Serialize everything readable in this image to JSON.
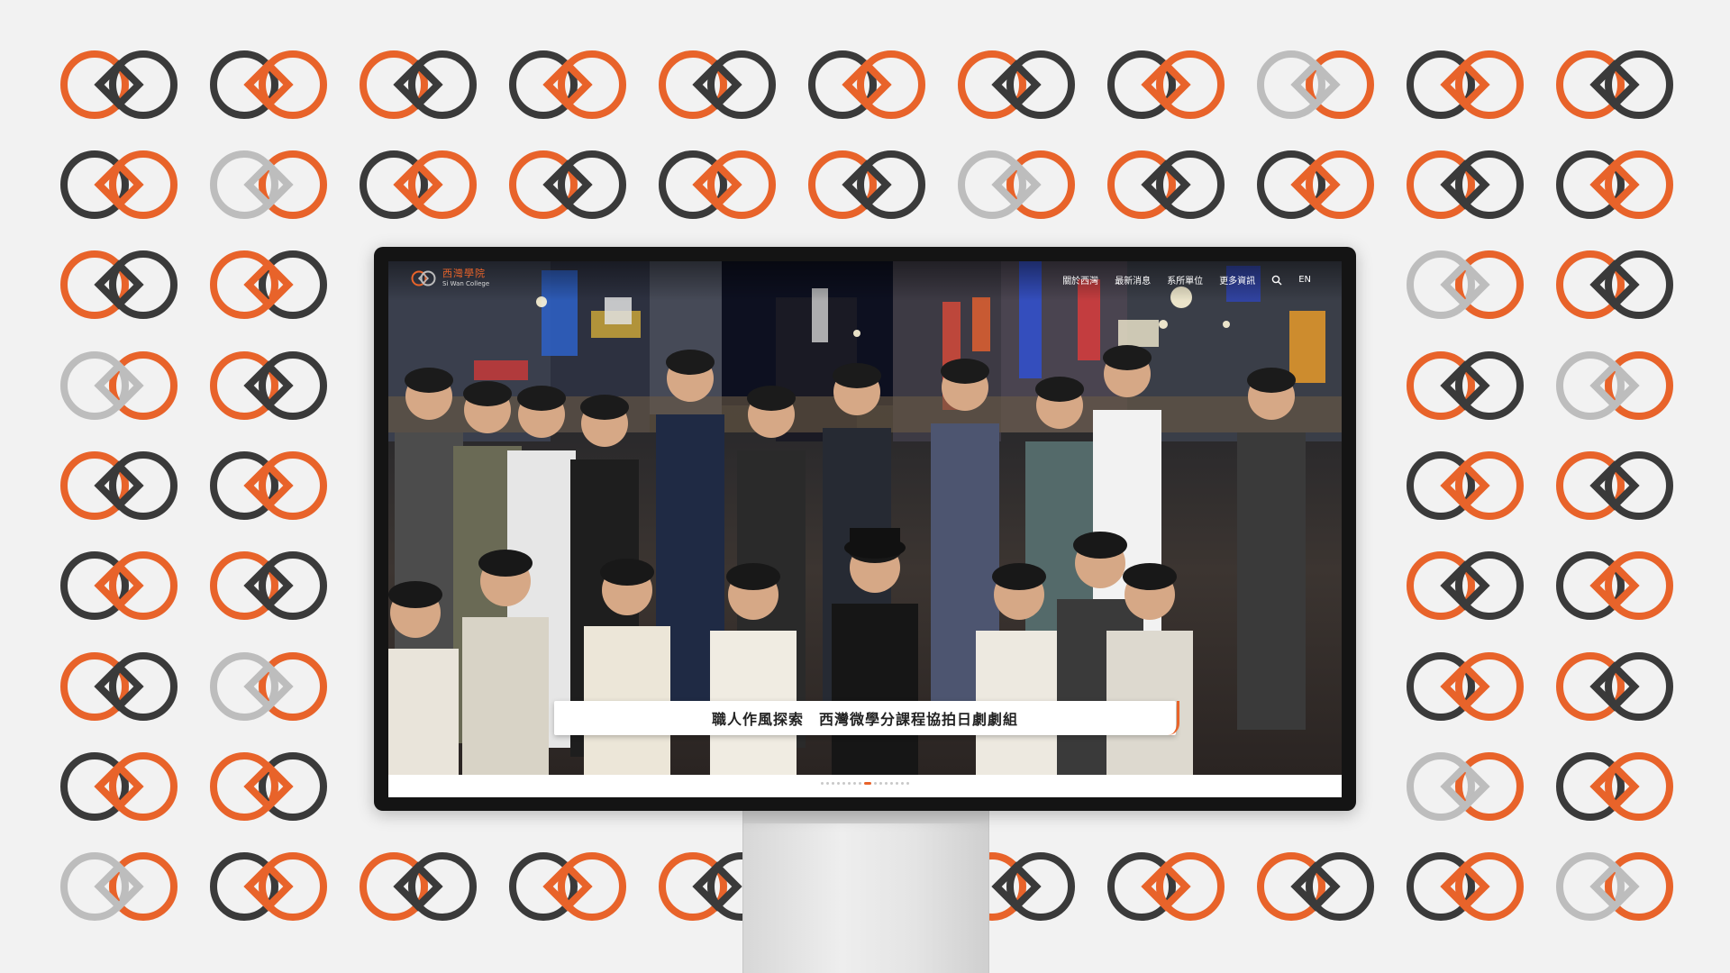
{
  "colors": {
    "accent": "#e8632a",
    "dark": "#3a3a3a",
    "light": "#bdbdbd",
    "background": "#f2f2f2"
  },
  "background_pattern": {
    "icon": "interlinked-rings-logo"
  },
  "website": {
    "logo": {
      "icon": "rings-logo-icon",
      "title": "西灣學院",
      "subtitle": "Si Wan College"
    },
    "nav": {
      "items": [
        "關於西灣",
        "最新消息",
        "系所單位",
        "更多資訊"
      ],
      "search_icon": "search-icon",
      "lang": "EN"
    },
    "hero": {
      "caption": "職人作風探索　西灣微學分課程協拍日劇劇組"
    },
    "pager": {
      "count": 16,
      "active": 8
    }
  }
}
